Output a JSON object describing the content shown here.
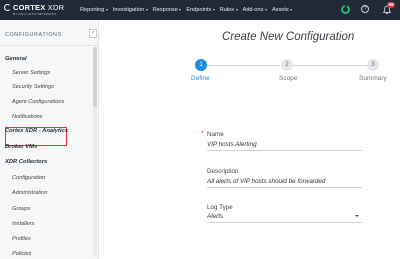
{
  "topbar": {
    "logo": {
      "brand": "CORTEX",
      "product": "XDR",
      "tagline": "BY PALO ALTO NETWORKS"
    },
    "nav": [
      "Reporting",
      "Investigation",
      "Response",
      "Endpoints",
      "Rules",
      "Add-ons",
      "Assets"
    ],
    "help_glyph": "?",
    "notification_count": "99",
    "colors": {
      "background": "#1f2a36",
      "status_ring": "#2bb673",
      "badge": "#e0313b"
    }
  },
  "sidebar": {
    "title": "CONFIGURATIONS",
    "collapse_glyph": "‹",
    "groups": [
      {
        "label": "General",
        "items": [
          "Server Settings",
          "Security Settings",
          "Agent Configurations",
          "Notifications"
        ]
      },
      {
        "label": "Cortex XDR - Analytics",
        "items": []
      },
      {
        "label": "Broker VMs",
        "items": []
      },
      {
        "label": "XDR Collectors",
        "items": [
          "Configuration",
          "Administration",
          "Groups",
          "Installers",
          "Profiles",
          "Policies"
        ]
      }
    ],
    "selected_item": "Notifications"
  },
  "main": {
    "title": "Create New Configuration",
    "steps": [
      {
        "number": "1",
        "label": "Define",
        "active": true
      },
      {
        "number": "2",
        "label": "Scope",
        "active": false
      },
      {
        "number": "3",
        "label": "Summary",
        "active": false
      }
    ],
    "fields": {
      "name": {
        "label": "Name",
        "required_mark": "*",
        "value": "VIP hosts Alerting"
      },
      "description": {
        "label": "Description",
        "value": "All alerts of VIP hosts should be forwarded"
      },
      "log_type": {
        "label": "Log Type",
        "value": "Alerts"
      }
    },
    "colors": {
      "accent": "#1e8ee0"
    }
  }
}
